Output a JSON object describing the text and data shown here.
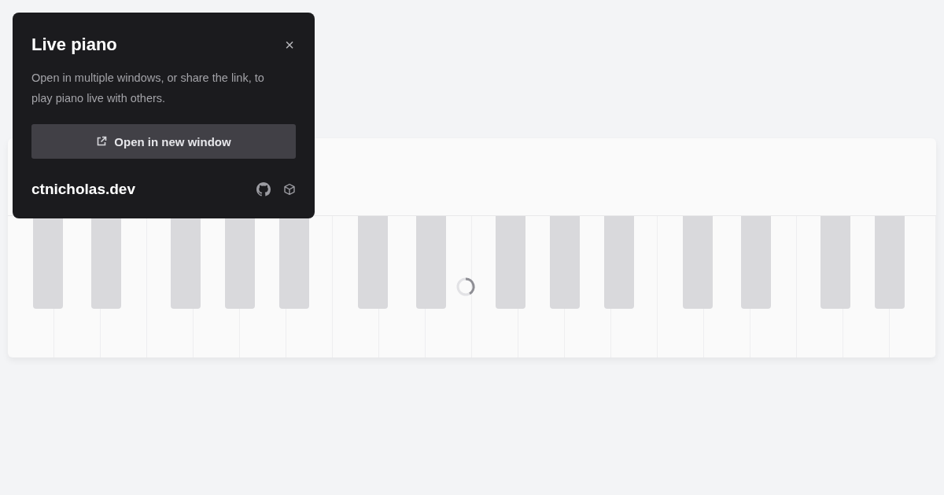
{
  "popup": {
    "title": "Live piano",
    "close": "×",
    "description": "Open in multiple windows, or share the link, to play piano live with others.",
    "button": "Open in new window",
    "site": "ctnicholas.dev"
  },
  "piano": {
    "loading": true
  }
}
